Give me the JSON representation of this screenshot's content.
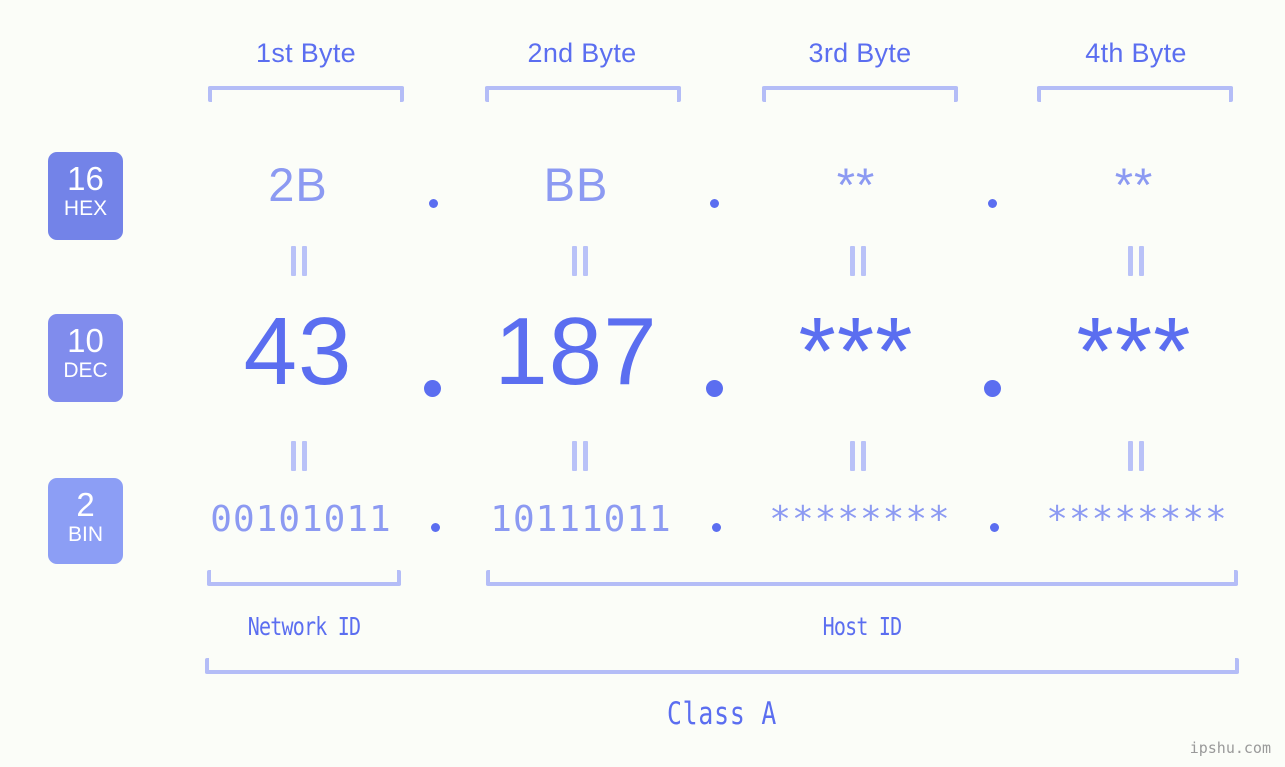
{
  "background_color": "#fbfdf8",
  "accent_color": "#5b6ef0",
  "accent_light_color": "#8c9af2",
  "bracket_color": "#b4bdf7",
  "watermark": "ipshu.com",
  "byte_headers": [
    {
      "label": "1st Byte"
    },
    {
      "label": "2nd Byte"
    },
    {
      "label": "3rd Byte"
    },
    {
      "label": "4th Byte"
    }
  ],
  "radix_badges": [
    {
      "number": "16",
      "name": "HEX",
      "color": "#7383e8"
    },
    {
      "number": "10",
      "name": "DEC",
      "color": "#808ced"
    },
    {
      "number": "2",
      "name": "BIN",
      "color": "#8c9ef5"
    }
  ],
  "rows": {
    "hex": {
      "values": [
        "2B",
        "BB",
        "**",
        "**"
      ],
      "separator": "."
    },
    "dec": {
      "values": [
        "43",
        "187",
        "***",
        "***"
      ],
      "separator": "."
    },
    "bin": {
      "values": [
        "00101011",
        "10111011",
        "********",
        "********"
      ],
      "separator": "."
    }
  },
  "equals_symbol": "=",
  "id_labels": [
    {
      "label": "Network ID"
    },
    {
      "label": "Host ID"
    }
  ],
  "class_label": "Class A"
}
